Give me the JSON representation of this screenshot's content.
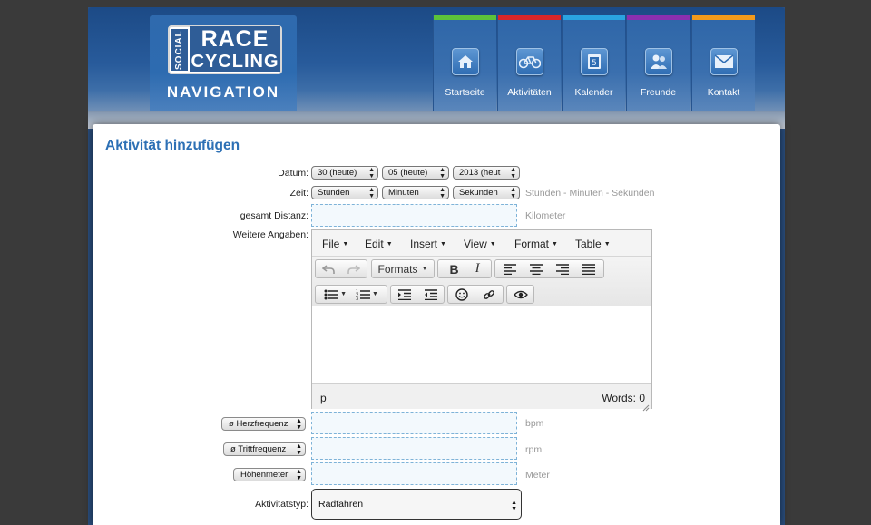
{
  "brand": {
    "logo_side": "SOCIAL",
    "logo_top": "RACE",
    "logo_bottom": "CYCLING",
    "nav_title": "NAVIGATION"
  },
  "nav": [
    {
      "label": "Startseite",
      "icon": "home-icon",
      "color": "#5cc23a"
    },
    {
      "label": "Aktivitäten",
      "icon": "bicycle-icon",
      "color": "#d9262a"
    },
    {
      "label": "Kalender",
      "icon": "calendar-icon",
      "color": "#2aa3e0"
    },
    {
      "label": "Freunde",
      "icon": "friends-icon",
      "color": "#8b2fb0"
    },
    {
      "label": "Kontakt",
      "icon": "mail-icon",
      "color": "#f29a1c"
    }
  ],
  "page": {
    "title": "Aktivität hinzufügen"
  },
  "form": {
    "date_label": "Datum:",
    "date_day": "30 (heute)",
    "date_month": "05 (heute)",
    "date_year": "2013 (heut",
    "time_label": "Zeit:",
    "time_hours": "Stunden",
    "time_minutes": "Minuten",
    "time_seconds": "Sekunden",
    "time_hint": "Stunden - Minuten - Sekunden",
    "distance_label": "gesamt Distanz:",
    "distance_value": "",
    "distance_unit": "Kilometer",
    "details_label": "Weitere Angaben:",
    "heart_rate_select": "ø Herzfrequenz",
    "heart_rate_unit": "bpm",
    "cadence_select": "ø Trittfrequenz",
    "cadence_unit": "rpm",
    "elevation_select": "Höhenmeter",
    "elevation_unit": "Meter",
    "activity_type_label": "Aktivitätstyp:",
    "activity_type_value": "Radfahren"
  },
  "editor": {
    "menu": [
      "File",
      "Edit",
      "Insert",
      "View",
      "Format",
      "Table"
    ],
    "formats_label": "Formats",
    "bold_label": "B",
    "italic_label": "I",
    "status_path": "p",
    "word_count": "Words: 0"
  }
}
